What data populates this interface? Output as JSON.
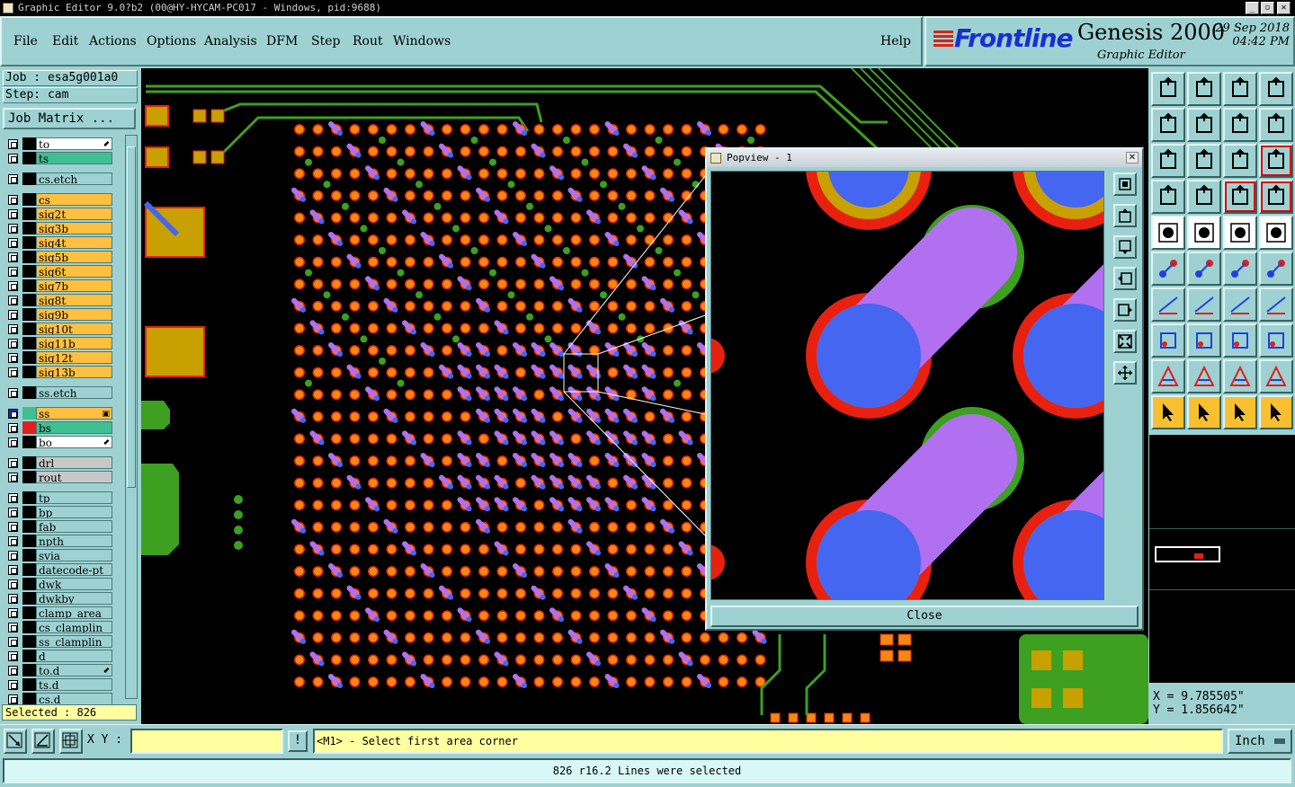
{
  "window": {
    "title": "Graphic Editor 9.0?b2 (00@HY-HYCAM-PC017 - Windows, pid:9688)",
    "buttons": [
      "_",
      "▫",
      "✕"
    ]
  },
  "menu": {
    "items": [
      "File",
      "Edit",
      "Actions",
      "Options",
      "Analysis",
      "DFM",
      "Step",
      "Rout",
      "Windows"
    ],
    "help": "Help"
  },
  "brand": {
    "logo": "Frontline",
    "product": "Genesis 2000",
    "subtitle": "Graphic Editor",
    "date": "29 Sep 2018",
    "time": "04:42 PM"
  },
  "job": {
    "job_label": "Job : esa5g001a0",
    "step_label": "Step: cam",
    "matrix_button": "Job Matrix ..."
  },
  "layers": [
    {
      "name": "to",
      "bg": "#ffffff",
      "tag": "⬋"
    },
    {
      "name": "ts",
      "bg": "#40c090"
    },
    {
      "name": "cs.etch",
      "bg": "#9ed2d2"
    },
    {
      "name": "cs",
      "bg": "#ffc040"
    },
    {
      "name": "sig2t",
      "bg": "#ffc040"
    },
    {
      "name": "sig3b",
      "bg": "#ffc040"
    },
    {
      "name": "sig4t",
      "bg": "#ffc040"
    },
    {
      "name": "sig5b",
      "bg": "#ffc040"
    },
    {
      "name": "sig6t",
      "bg": "#ffc040"
    },
    {
      "name": "sig7b",
      "bg": "#ffc040"
    },
    {
      "name": "sig8t",
      "bg": "#ffc040"
    },
    {
      "name": "sig9b",
      "bg": "#ffc040"
    },
    {
      "name": "sig10t",
      "bg": "#ffc040"
    },
    {
      "name": "sig11b",
      "bg": "#ffc040"
    },
    {
      "name": "sig12t",
      "bg": "#ffc040"
    },
    {
      "name": "sig13b",
      "bg": "#ffc040"
    },
    {
      "name": "ss.etch",
      "bg": "#9ed2d2"
    },
    {
      "name": "ss",
      "bg": "#ffc040",
      "tag": "▣",
      "active": true
    },
    {
      "name": "bs",
      "bg": "#40c090",
      "swatch": "#e02020"
    },
    {
      "name": "bo",
      "bg": "#ffffff",
      "tag": "⬋"
    },
    {
      "name": "drl",
      "bg": "#c8c8c8"
    },
    {
      "name": "rout",
      "bg": "#c8c8c8"
    },
    {
      "name": "tp",
      "bg": "#9ed2d2"
    },
    {
      "name": "bp",
      "bg": "#9ed2d2"
    },
    {
      "name": "fab",
      "bg": "#9ed2d2"
    },
    {
      "name": "npth",
      "bg": "#9ed2d2"
    },
    {
      "name": "svia",
      "bg": "#9ed2d2"
    },
    {
      "name": "datecode-pt",
      "bg": "#9ed2d2"
    },
    {
      "name": "dwk",
      "bg": "#9ed2d2"
    },
    {
      "name": "dwkby",
      "bg": "#9ed2d2"
    },
    {
      "name": "clamp_area",
      "bg": "#9ed2d2"
    },
    {
      "name": "cs_clamplin",
      "bg": "#9ed2d2"
    },
    {
      "name": "ss_clamplin",
      "bg": "#9ed2d2"
    },
    {
      "name": "d",
      "bg": "#9ed2d2"
    },
    {
      "name": "to.d",
      "bg": "#9ed2d2",
      "tag": "⬋"
    },
    {
      "name": "ts.d",
      "bg": "#9ed2d2"
    },
    {
      "name": "cs.d",
      "bg": "#9ed2d2"
    }
  ],
  "selected": "Selected : 826",
  "popview": {
    "title": "Popview - 1",
    "close": "Close"
  },
  "coords": {
    "x": "X = 9.785505\"",
    "y": "Y = 1.856642\""
  },
  "command": {
    "xy_label": "X Y :",
    "xy_value": "",
    "prompt": "<M1> - Select first area corner",
    "unit": "Inch"
  },
  "status": "826 r16.2 Lines were selected",
  "colors": {
    "pad": "#f08a10",
    "antipad": "#e82010",
    "trace": "#3da020",
    "via_line": "#b070f0",
    "via_pad": "#4466f0",
    "ring": "#c8a000"
  }
}
